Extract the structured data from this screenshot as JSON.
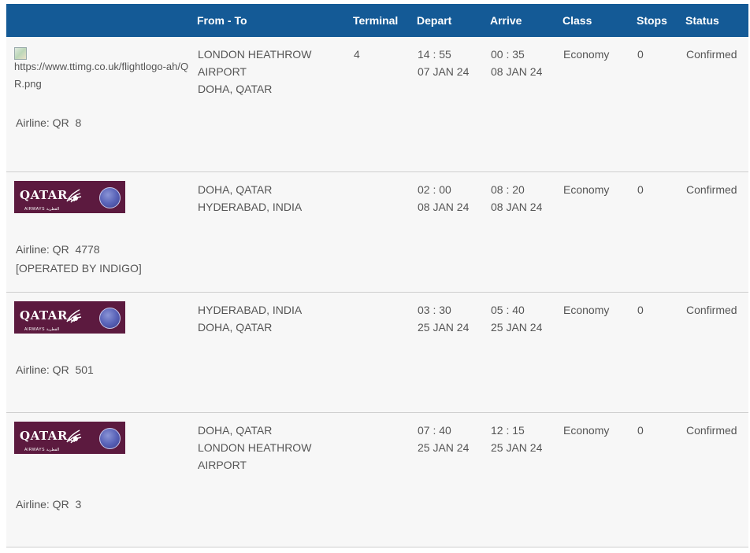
{
  "header": {
    "logo": "",
    "route": "From - To",
    "terminal": "Terminal",
    "depart": "Depart",
    "arrive": "Arrive",
    "class": "Class",
    "stops": "Stops",
    "status": "Status"
  },
  "flights": [
    {
      "logo_type": "broken",
      "logo_alt": "https://www.ttimg.co.uk/flightlogo-ah/QR.png",
      "airline_line": "Airline: QR  8",
      "operated_by": "",
      "from": "LONDON HEATHROW AIRPORT",
      "to": "DOHA, QATAR",
      "terminal": "4",
      "depart_time": "14 : 55",
      "depart_date": "07 JAN 24",
      "arrive_time": "00 : 35",
      "arrive_date": "08 JAN 24",
      "class": "Economy",
      "stops": "0",
      "status": "Confirmed"
    },
    {
      "logo_type": "qatar",
      "airline_line": "Airline: QR  4778",
      "operated_by": "[OPERATED BY INDIGO]",
      "from": "DOHA, QATAR",
      "to": "HYDERABAD, INDIA",
      "terminal": "",
      "depart_time": "02 : 00",
      "depart_date": "08 JAN 24",
      "arrive_time": "08 : 20",
      "arrive_date": "08 JAN 24",
      "class": "Economy",
      "stops": "0",
      "status": "Confirmed"
    },
    {
      "logo_type": "qatar",
      "airline_line": "Airline: QR  501",
      "operated_by": "",
      "from": "HYDERABAD, INDIA",
      "to": "DOHA, QATAR",
      "terminal": "",
      "depart_time": "03 : 30",
      "depart_date": "25 JAN 24",
      "arrive_time": "05 : 40",
      "arrive_date": "25 JAN 24",
      "class": "Economy",
      "stops": "0",
      "status": "Confirmed"
    },
    {
      "logo_type": "qatar",
      "airline_line": "Airline: QR  3",
      "operated_by": "",
      "from": "DOHA, QATAR",
      "to": "LONDON HEATHROW AIRPORT",
      "terminal": "",
      "depart_time": "07 : 40",
      "depart_date": "25 JAN 24",
      "arrive_time": "12 : 15",
      "arrive_date": "25 JAN 24",
      "class": "Economy",
      "stops": "0",
      "status": "Confirmed"
    }
  ],
  "logo": {
    "brand_word": "QATAR",
    "brand_sub": "AIRWAYS القطرية",
    "brand_color": "#5c1a3f",
    "icon_names": [
      "oryx-icon",
      "oneworld-icon",
      "broken-image-icon"
    ]
  },
  "colors": {
    "header_bg": "#145a96",
    "row_bg": "#f7f7f7",
    "text": "#555555"
  }
}
